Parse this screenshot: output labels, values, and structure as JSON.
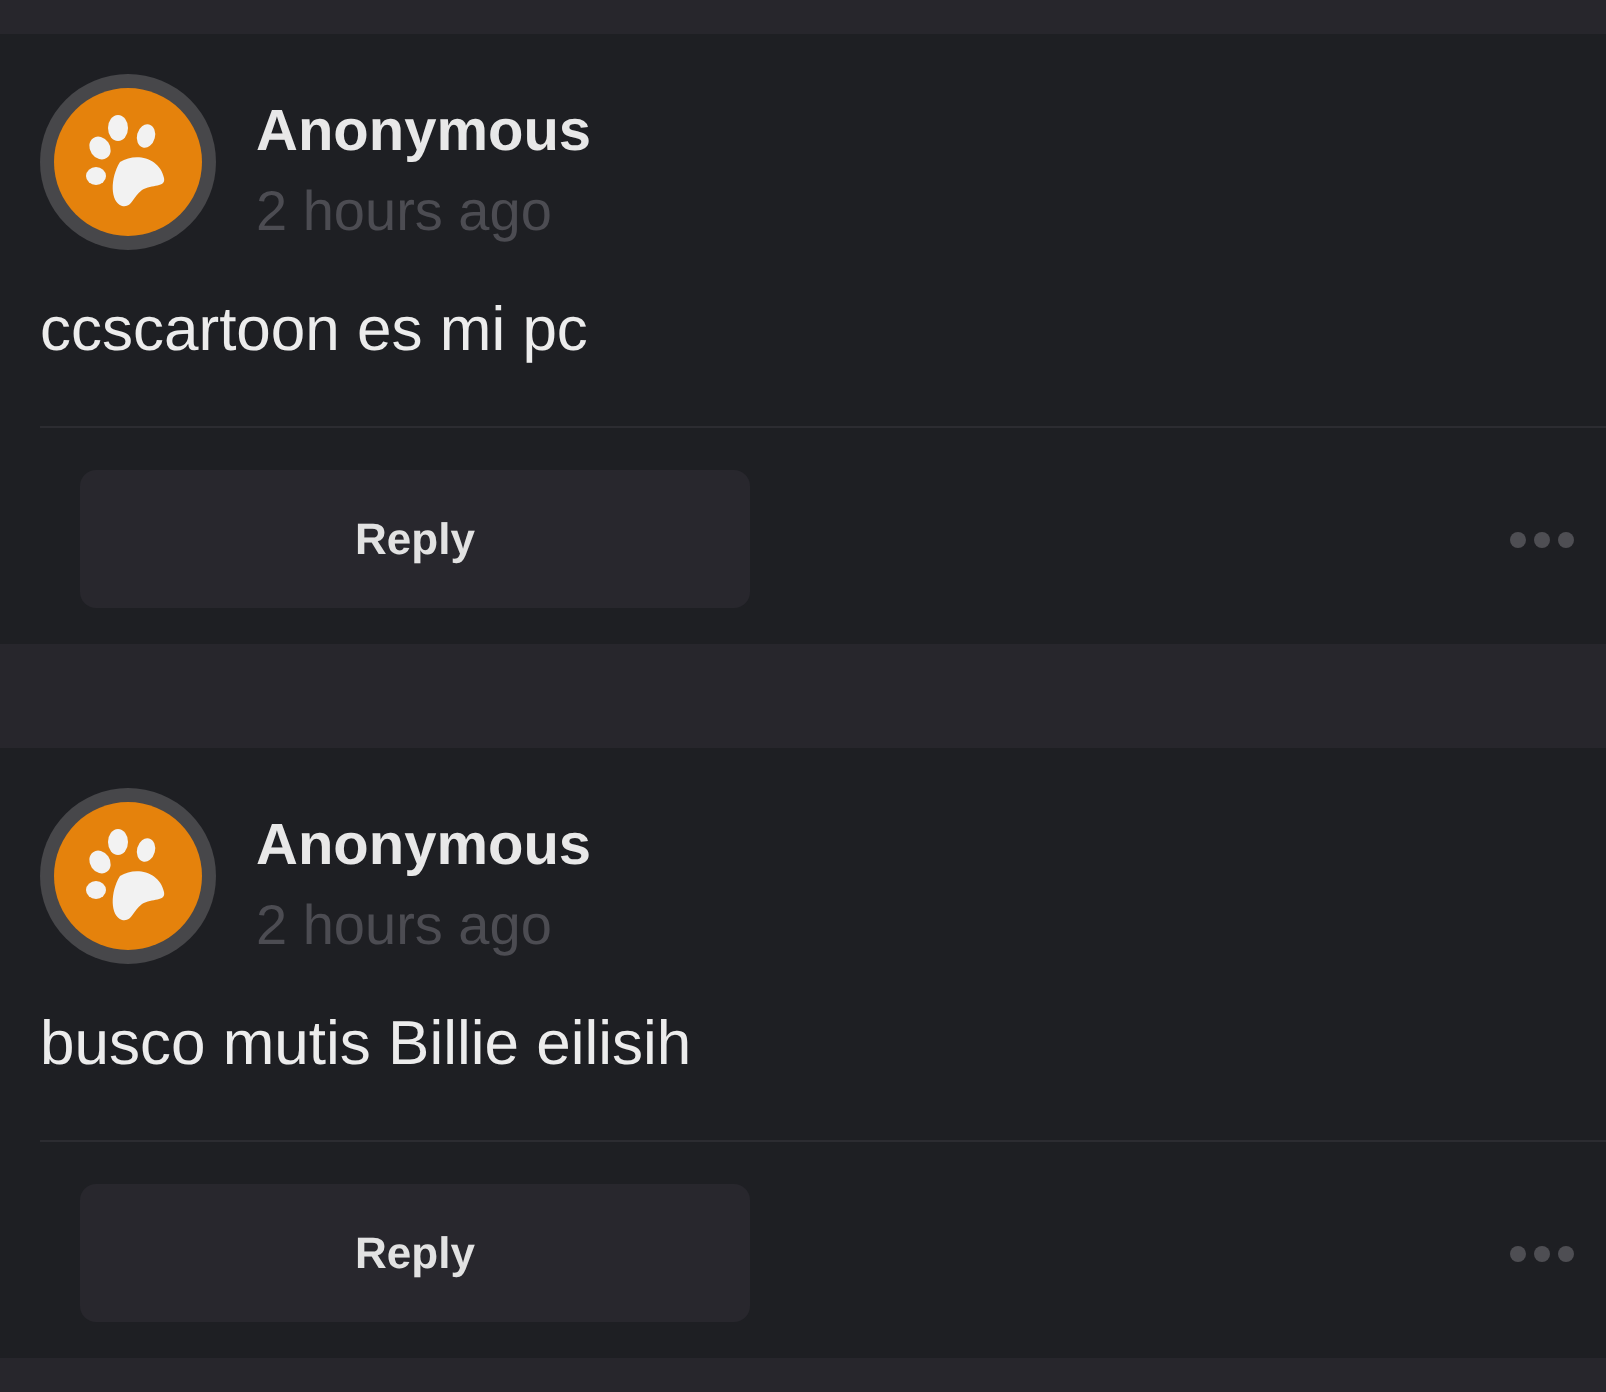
{
  "comments": [
    {
      "author": "Anonymous",
      "time": "2 hours ago",
      "text": "ccscartoon es mi pc",
      "reply_button": "Reply"
    },
    {
      "author": "Anonymous",
      "time": "2 hours ago",
      "text": "busco mutis Billie eilisih",
      "reply_button": "Reply"
    }
  ]
}
